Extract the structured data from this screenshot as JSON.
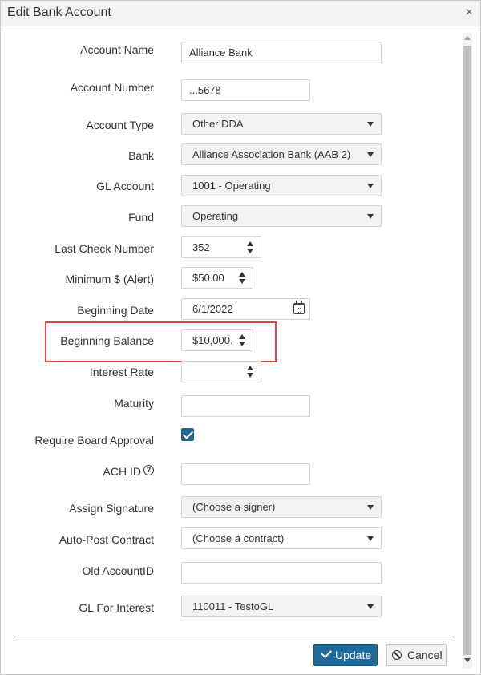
{
  "dialog": {
    "title": "Edit Bank Account",
    "close_glyph": "×"
  },
  "fields": {
    "account_name": {
      "label": "Account Name",
      "value": "Alliance Bank"
    },
    "account_number": {
      "label": "Account Number",
      "value": "...5678"
    },
    "account_type": {
      "label": "Account Type",
      "value": "Other DDA"
    },
    "bank": {
      "label": "Bank",
      "value": "Alliance Association Bank (AAB 2)"
    },
    "gl_account": {
      "label": "GL Account",
      "value": "1001 - Operating"
    },
    "fund": {
      "label": "Fund",
      "value": "Operating"
    },
    "last_check_number": {
      "label": "Last Check Number",
      "value": "352"
    },
    "minimum_alert": {
      "label": "Minimum $ (Alert)",
      "value": "$50.00"
    },
    "beginning_date": {
      "label": "Beginning Date",
      "value": "6/1/2022"
    },
    "beginning_balance": {
      "label": "Beginning Balance",
      "value": "$10,000."
    },
    "interest_rate": {
      "label": "Interest Rate",
      "value": ""
    },
    "maturity": {
      "label": "Maturity",
      "value": ""
    },
    "require_board_approval": {
      "label": "Require Board Approval",
      "checked": true
    },
    "ach_id": {
      "label": "ACH ID",
      "value": "",
      "help_glyph": "?"
    },
    "assign_signature": {
      "label": "Assign Signature",
      "value": "(Choose a signer)"
    },
    "auto_post_contract": {
      "label": "Auto-Post Contract",
      "value": "(Choose a contract)"
    },
    "old_account_id": {
      "label": "Old AccountID",
      "value": ""
    },
    "gl_for_interest": {
      "label": "GL For Interest",
      "value": "110011 - TestoGL"
    }
  },
  "buttons": {
    "update": "Update",
    "cancel": "Cancel"
  },
  "colors": {
    "primary": "#1f6a9a",
    "checkbox": "#246590",
    "highlight": "#e04545"
  },
  "icons": {
    "close": "close-icon",
    "caret": "chevron-down-icon",
    "spinner": "spinner-arrows-icon",
    "calendar": "calendar-icon",
    "help": "help-circle-icon",
    "update": "checkmark-icon",
    "cancel": "ban-icon"
  }
}
